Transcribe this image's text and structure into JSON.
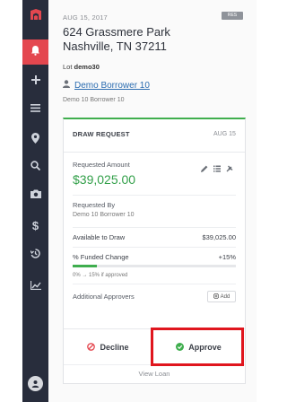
{
  "sidebar": {
    "logo_icon": "app-logo-icon",
    "items": [
      {
        "icon": "bell-icon",
        "active": true
      },
      {
        "icon": "plus-icon"
      },
      {
        "icon": "list-icon"
      },
      {
        "icon": "map-pin-icon"
      },
      {
        "icon": "search-icon"
      },
      {
        "icon": "camera-icon"
      },
      {
        "icon": "dollar-icon"
      },
      {
        "icon": "history-icon"
      },
      {
        "icon": "chart-icon"
      }
    ],
    "avatar_icon": "user-avatar-icon",
    "accent": "#e4474f",
    "background": "#282d3c"
  },
  "property": {
    "date": "AUG 15, 2017",
    "badge": "RES",
    "address_line1": "624 Grassmere Park",
    "address_line2": "Nashville, TN 37211",
    "lot_label": "Lot",
    "lot_value": "demo30",
    "borrower_name": "Demo Borrower 10",
    "borrower_sub": "Demo 10 Borrower 10"
  },
  "draw_request": {
    "title": "DRAW REQUEST",
    "date": "AUG 15",
    "requested_amount_label": "Requested Amount",
    "requested_amount": "$39,025.00",
    "requested_by_label": "Requested By",
    "requested_by": "Demo 10 Borrower 10",
    "available_label": "Available to Draw",
    "available_value": "$39,025.00",
    "funded_label": "% Funded Change",
    "funded_value": "+15%",
    "funded_progress": 0.15,
    "progress_note": "0% → 15% if approved",
    "approvers_label": "Additional Approvers",
    "add_label": "Add",
    "decline_label": "Decline",
    "approve_label": "Approve",
    "view_loan_label": "View Loan",
    "accent_green": "#33a04a",
    "highlight_color": "#e0161e"
  }
}
